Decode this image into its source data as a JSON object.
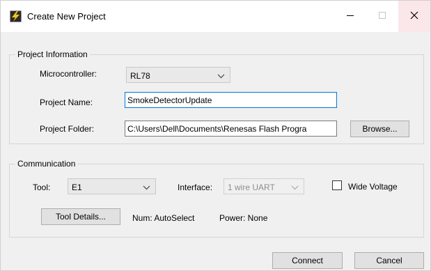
{
  "window": {
    "title": "Create New Project",
    "icons": {
      "app": "lightning-bolt-icon",
      "minimize": "minimize-icon",
      "maximize": "maximize-icon",
      "close": "close-icon"
    }
  },
  "project_information": {
    "group_title": "Project Information",
    "microcontroller": {
      "label": "Microcontroller:",
      "value": "RL78"
    },
    "project_name": {
      "label": "Project Name:",
      "value": "SmokeDetectorUpdate"
    },
    "project_folder": {
      "label": "Project Folder:",
      "value": "C:\\Users\\Dell\\Documents\\Renesas Flash Progra"
    },
    "browse_label": "Browse..."
  },
  "communication": {
    "group_title": "Communication",
    "tool": {
      "label": "Tool:",
      "value": "E1"
    },
    "interface": {
      "label": "Interface:",
      "value": "1 wire UART"
    },
    "wide_voltage_label": "Wide Voltage",
    "wide_voltage_checked": false,
    "tool_details_label": "Tool Details...",
    "num_text": "Num: AutoSelect",
    "power_text": "Power: None"
  },
  "footer": {
    "connect_label": "Connect",
    "cancel_label": "Cancel"
  },
  "colors": {
    "focus": "#0078d7",
    "close_hover": "#fbe6e9",
    "disabled_text": "#8d8d8d"
  }
}
